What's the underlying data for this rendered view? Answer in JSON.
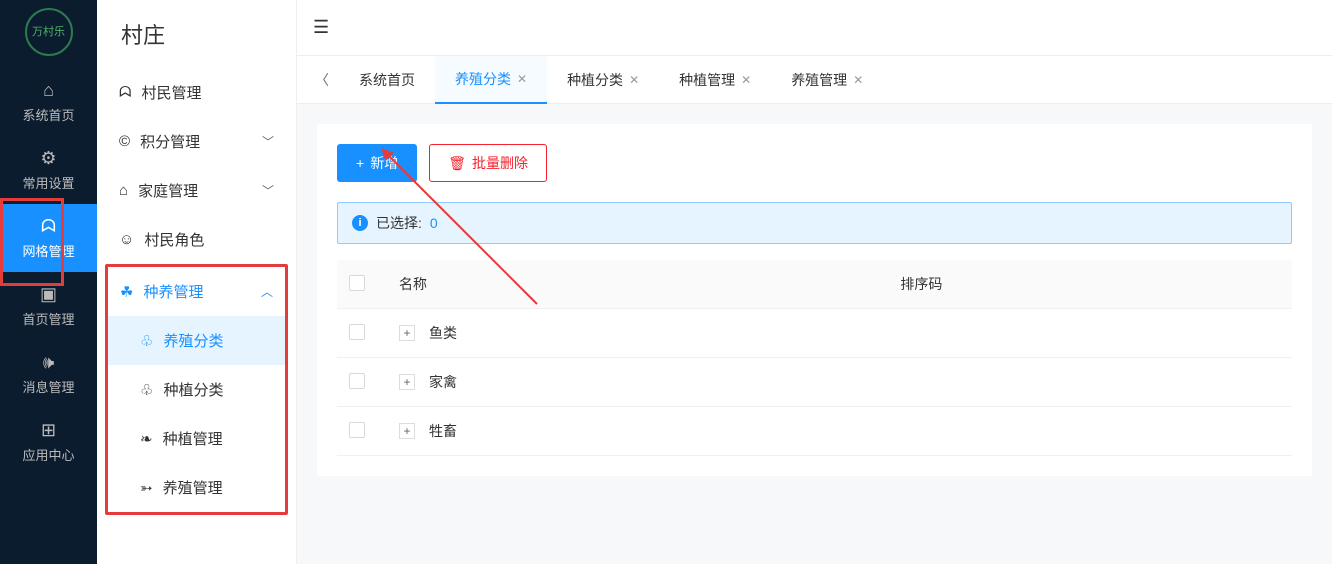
{
  "nav": {
    "items": [
      {
        "label": "系统首页",
        "icon": "home"
      },
      {
        "label": "常用设置",
        "icon": "gear"
      },
      {
        "label": "网格管理",
        "icon": "user",
        "active": true
      },
      {
        "label": "首页管理",
        "icon": "layout"
      },
      {
        "label": "消息管理",
        "icon": "speaker"
      },
      {
        "label": "应用中心",
        "icon": "apps"
      }
    ]
  },
  "sidebar": {
    "title": "村庄",
    "menu": [
      {
        "label": "村民管理",
        "icon": "person"
      },
      {
        "label": "积分管理",
        "icon": "coin",
        "expandable": true
      },
      {
        "label": "家庭管理",
        "icon": "home2",
        "expandable": true
      },
      {
        "label": "村民角色",
        "icon": "smile"
      },
      {
        "label": "种养管理",
        "icon": "leaf",
        "expandable": true,
        "open": true,
        "children": [
          {
            "label": "养殖分类",
            "icon": "tree",
            "active": true
          },
          {
            "label": "种植分类",
            "icon": "tree"
          },
          {
            "label": "种植管理",
            "icon": "sprout"
          },
          {
            "label": "养殖管理",
            "icon": "cow"
          }
        ]
      }
    ]
  },
  "tabs": {
    "items": [
      {
        "label": "系统首页",
        "closable": false
      },
      {
        "label": "养殖分类",
        "closable": true,
        "active": true
      },
      {
        "label": "种植分类",
        "closable": true
      },
      {
        "label": "种植管理",
        "closable": true
      },
      {
        "label": "养殖管理",
        "closable": true
      }
    ]
  },
  "toolbar": {
    "add_label": "新增",
    "delete_label": "批量删除"
  },
  "alert": {
    "text": "已选择:",
    "count": "0"
  },
  "table": {
    "headers": {
      "name": "名称",
      "sort": "排序码"
    },
    "rows": [
      {
        "name": "鱼类"
      },
      {
        "name": "家禽"
      },
      {
        "name": "牲畜"
      }
    ]
  },
  "logo_text": "万村乐"
}
